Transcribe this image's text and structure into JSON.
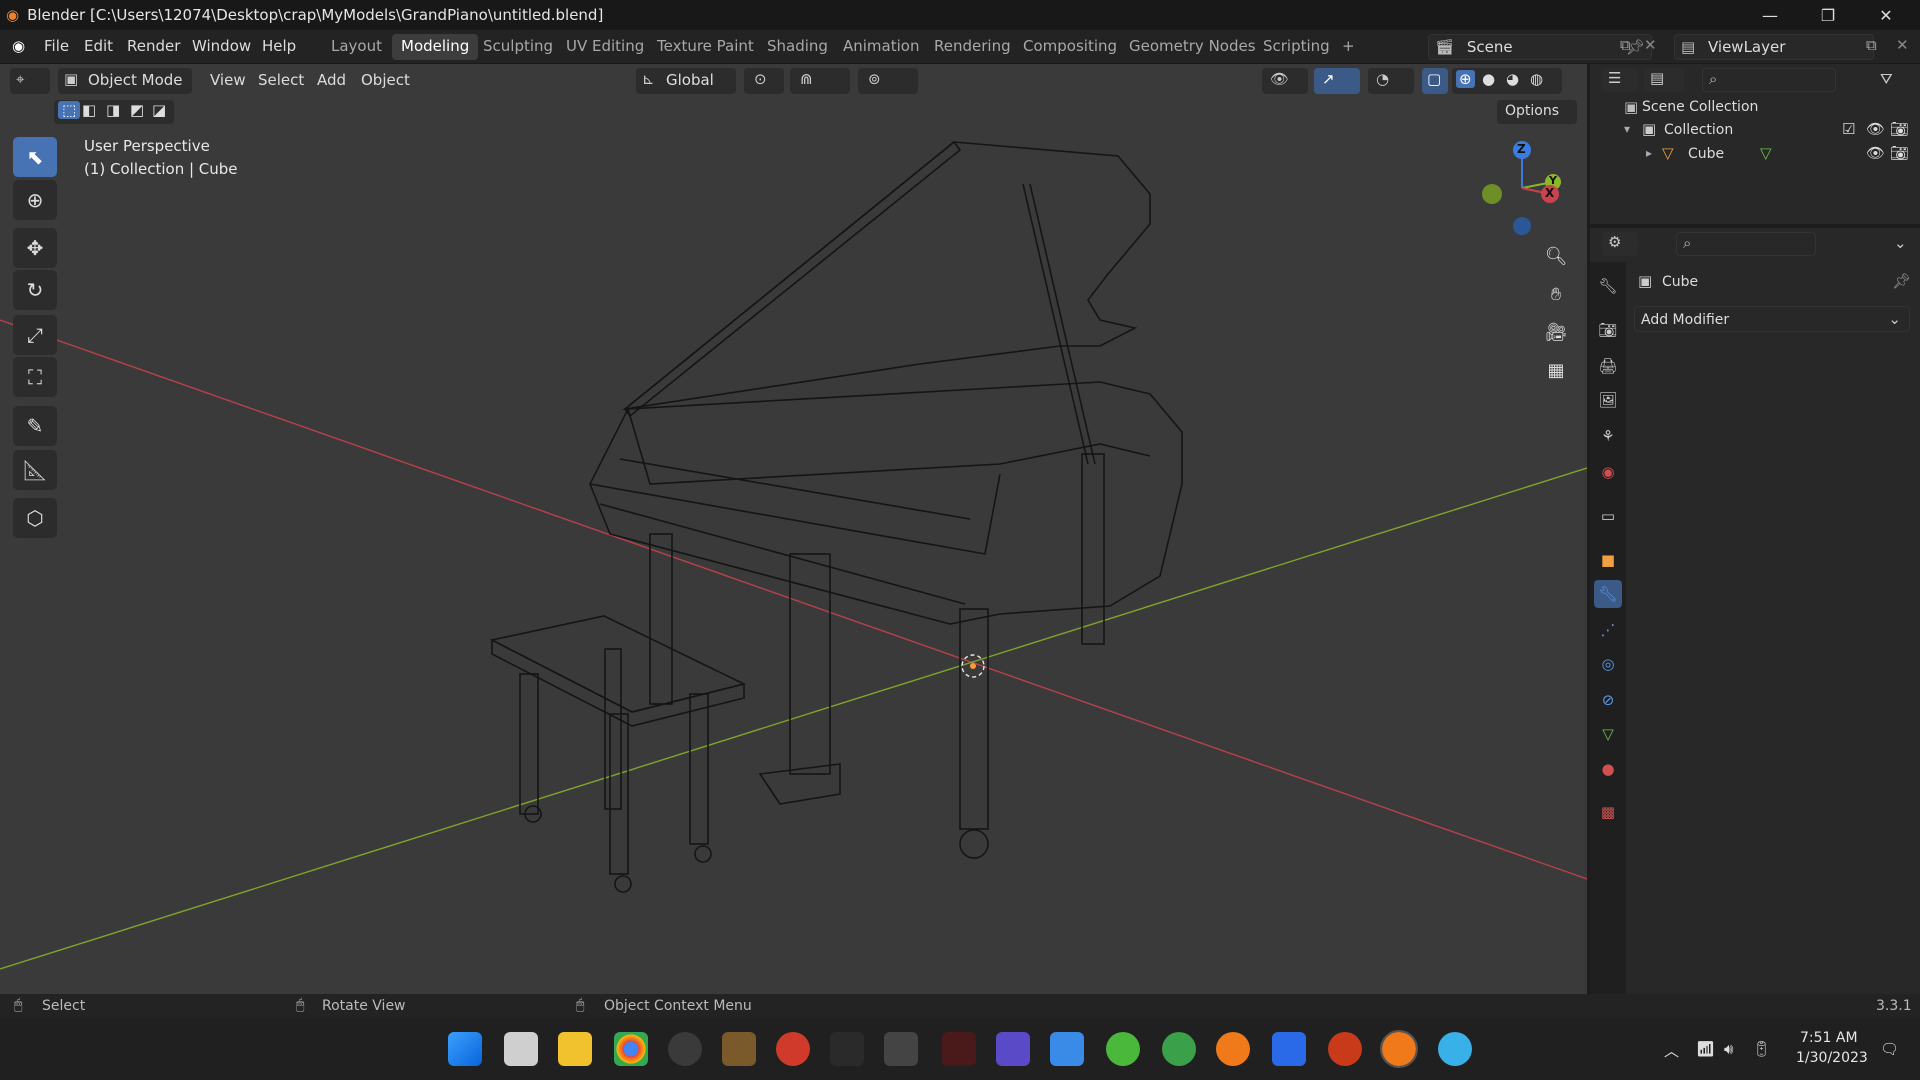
{
  "window": {
    "title": "Blender [C:\\Users\\12074\\Desktop\\crap\\MyModels\\GrandPiano\\untitled.blend]",
    "minimize_icon": "minimize-icon",
    "maximize_icon": "restore-icon",
    "close_icon": "close-icon"
  },
  "menubar": {
    "items": [
      "File",
      "Edit",
      "Render",
      "Window",
      "Help"
    ],
    "workspaces": [
      "Layout",
      "Modeling",
      "Sculpting",
      "UV Editing",
      "Texture Paint",
      "Shading",
      "Animation",
      "Rendering",
      "Compositing",
      "Geometry Nodes",
      "Scripting"
    ],
    "active_workspace": "Modeling",
    "add_workspace": "+",
    "scene": "Scene",
    "view_layer": "ViewLayer"
  },
  "viewport_header": {
    "mode": "Object Mode",
    "menus": [
      "View",
      "Select",
      "Add",
      "Object"
    ],
    "orientation": "Global",
    "options": "Options"
  },
  "viewport": {
    "perspective": "User Perspective",
    "context": "(1) Collection | Cube",
    "gizmo_axes": [
      "Z",
      "Y",
      "X"
    ]
  },
  "outliner": {
    "scene_collection": "Scene Collection",
    "collection": "Collection",
    "object": "Cube"
  },
  "properties": {
    "object_name": "Cube",
    "add_modifier": "Add Modifier"
  },
  "statusbar": {
    "select": "Select",
    "rotate": "Rotate View",
    "context_menu": "Object Context Menu",
    "version": "3.3.1"
  },
  "taskbar": {
    "time": "7:51 AM",
    "date": "1/30/2023"
  },
  "colors": {
    "accent": "#4772b3",
    "x_axis": "#c8434c",
    "y_axis": "#8bb82a",
    "z_axis": "#3b7ce0",
    "viewport_bg": "#3a3a3a"
  }
}
